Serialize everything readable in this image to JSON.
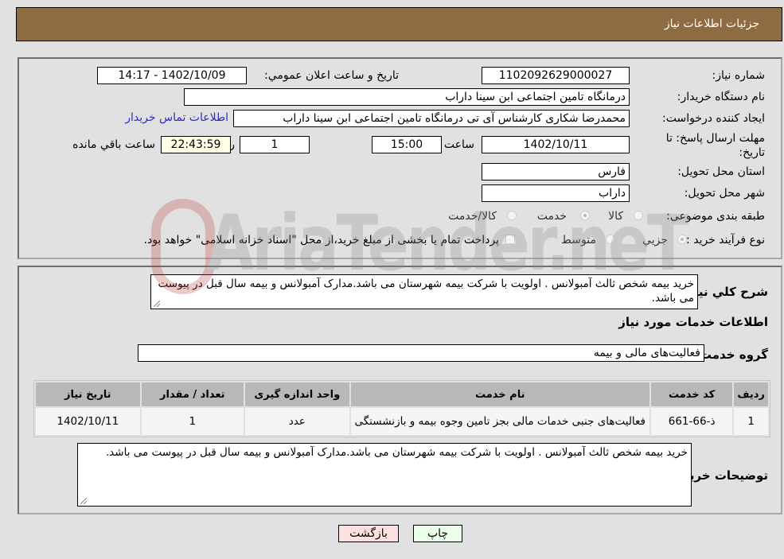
{
  "header": {
    "title": "جزئیات اطلاعات نیاز"
  },
  "form": {
    "need_number": {
      "label": "شماره نیاز:",
      "value": "1102092629000027"
    },
    "announce_datetime": {
      "label": "تاريخ و ساعت اعلان عمومي:",
      "value": "1402/10/09 - 14:17"
    },
    "buyer_org": {
      "label": "نام دستگاه خريدار:",
      "value": "درمانگاه تامین اجتماعی ابن سینا داراب"
    },
    "requester": {
      "label": "ايجاد کننده درخواست:",
      "value": "محمدرضا شکاری کارشناس آی تی درمانگاه تامین اجتماعی ابن سینا داراب"
    },
    "buyer_contact_link": "اطلاعات تماس خريدار",
    "deadline": {
      "label": "مهلت ارسال پاسخ: تا تاریخ:",
      "date": "1402/10/11",
      "time_label": "ساعت",
      "time": "15:00",
      "days": "1",
      "days_label": "روز و",
      "remaining": "22:43:59",
      "remaining_label": "ساعت باقي مانده"
    },
    "province": {
      "label": "استان محل تحويل:",
      "value": "فارس"
    },
    "city": {
      "label": "شهر محل تحويل:",
      "value": "داراب"
    },
    "category": {
      "label": "طبقه بندی موضوعی:",
      "options": [
        {
          "label": "کالا",
          "checked": false
        },
        {
          "label": "خدمت",
          "checked": true
        },
        {
          "label": "کالا/خدمت",
          "checked": false
        }
      ]
    },
    "purchase_type": {
      "label": "نوع فرآيند خريد :",
      "options": [
        {
          "label": "جزيي",
          "checked": true
        },
        {
          "label": "متوسط",
          "checked": false
        }
      ],
      "treasury_checkbox_label": "پرداخت تمام يا بخشی از مبلغ خريد،از محل \"اسناد خزانه اسلامی\" خواهد بود."
    }
  },
  "description": {
    "label": "شرح کلي نياز:",
    "value": "خرید بیمه شخص ثالث آمبولانس . اولویت با شرکت بیمه شهرستان می باشد.مدارک آمبولانس و بیمه سال قبل در پیوست می باشد."
  },
  "services_section": {
    "title": "اطلاعات خدمات مورد نياز",
    "group_label": "گروه خدمت:",
    "group_value": "فعالیت‌های مالی و بیمه",
    "table": {
      "headers": [
        "رديف",
        "کد خدمت",
        "نام خدمت",
        "واحد اندازه گيری",
        "تعداد / مقدار",
        "تاريخ نياز"
      ],
      "rows": [
        [
          "1",
          "ذ-66-661",
          "فعالیت‌های جنبی خدمات مالی بجز تامین وجوه بیمه و بازنشستگی",
          "عدد",
          "1",
          "1402/10/11"
        ]
      ]
    }
  },
  "buyer_notes": {
    "label": "توضيحات خريدار:",
    "value": "خرید بیمه شخص ثالث آمبولانس . اولویت با شرکت بیمه شهرستان می باشد.مدارک آمبولانس و بیمه سال قبل در پیوست می باشد."
  },
  "buttons": {
    "print": "چاپ",
    "back": "بازگشت"
  },
  "watermark": {
    "text": "AriaTender.neT"
  },
  "colors": {
    "header_bg": "#8d6c42",
    "page_bg": "#e1e1e1",
    "link": "#2a2ad0",
    "print_btn": "#eaffea",
    "back_btn": "#ffe0e0"
  }
}
